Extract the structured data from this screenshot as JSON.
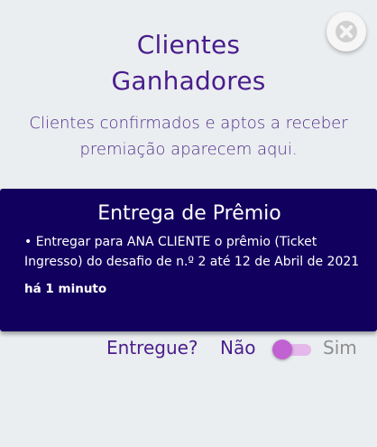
{
  "header": {
    "title_line1": "Clientes",
    "title_line2": "Ganhadores",
    "subtitle": "Clientes confirmados e aptos a receber premiação aparecem aqui."
  },
  "close_button": {
    "icon": "close-icon"
  },
  "card": {
    "title": "Entrega de Prêmio",
    "description": "• Entregar para ANA CLIENTE o prêmio (Ticket Ingresso) do desafio de n.º 2 até 12 de Abril de 2021",
    "time_ago": "há 1 minuto",
    "background_color": "#12005e"
  },
  "delivery_toggle": {
    "label": "Entregue?",
    "off_label": "Não",
    "on_label": "Sim",
    "checked": false,
    "accent_color": "#c261d2"
  },
  "colors": {
    "primary_text": "#4a1d8c",
    "background": "#ebeef0"
  }
}
